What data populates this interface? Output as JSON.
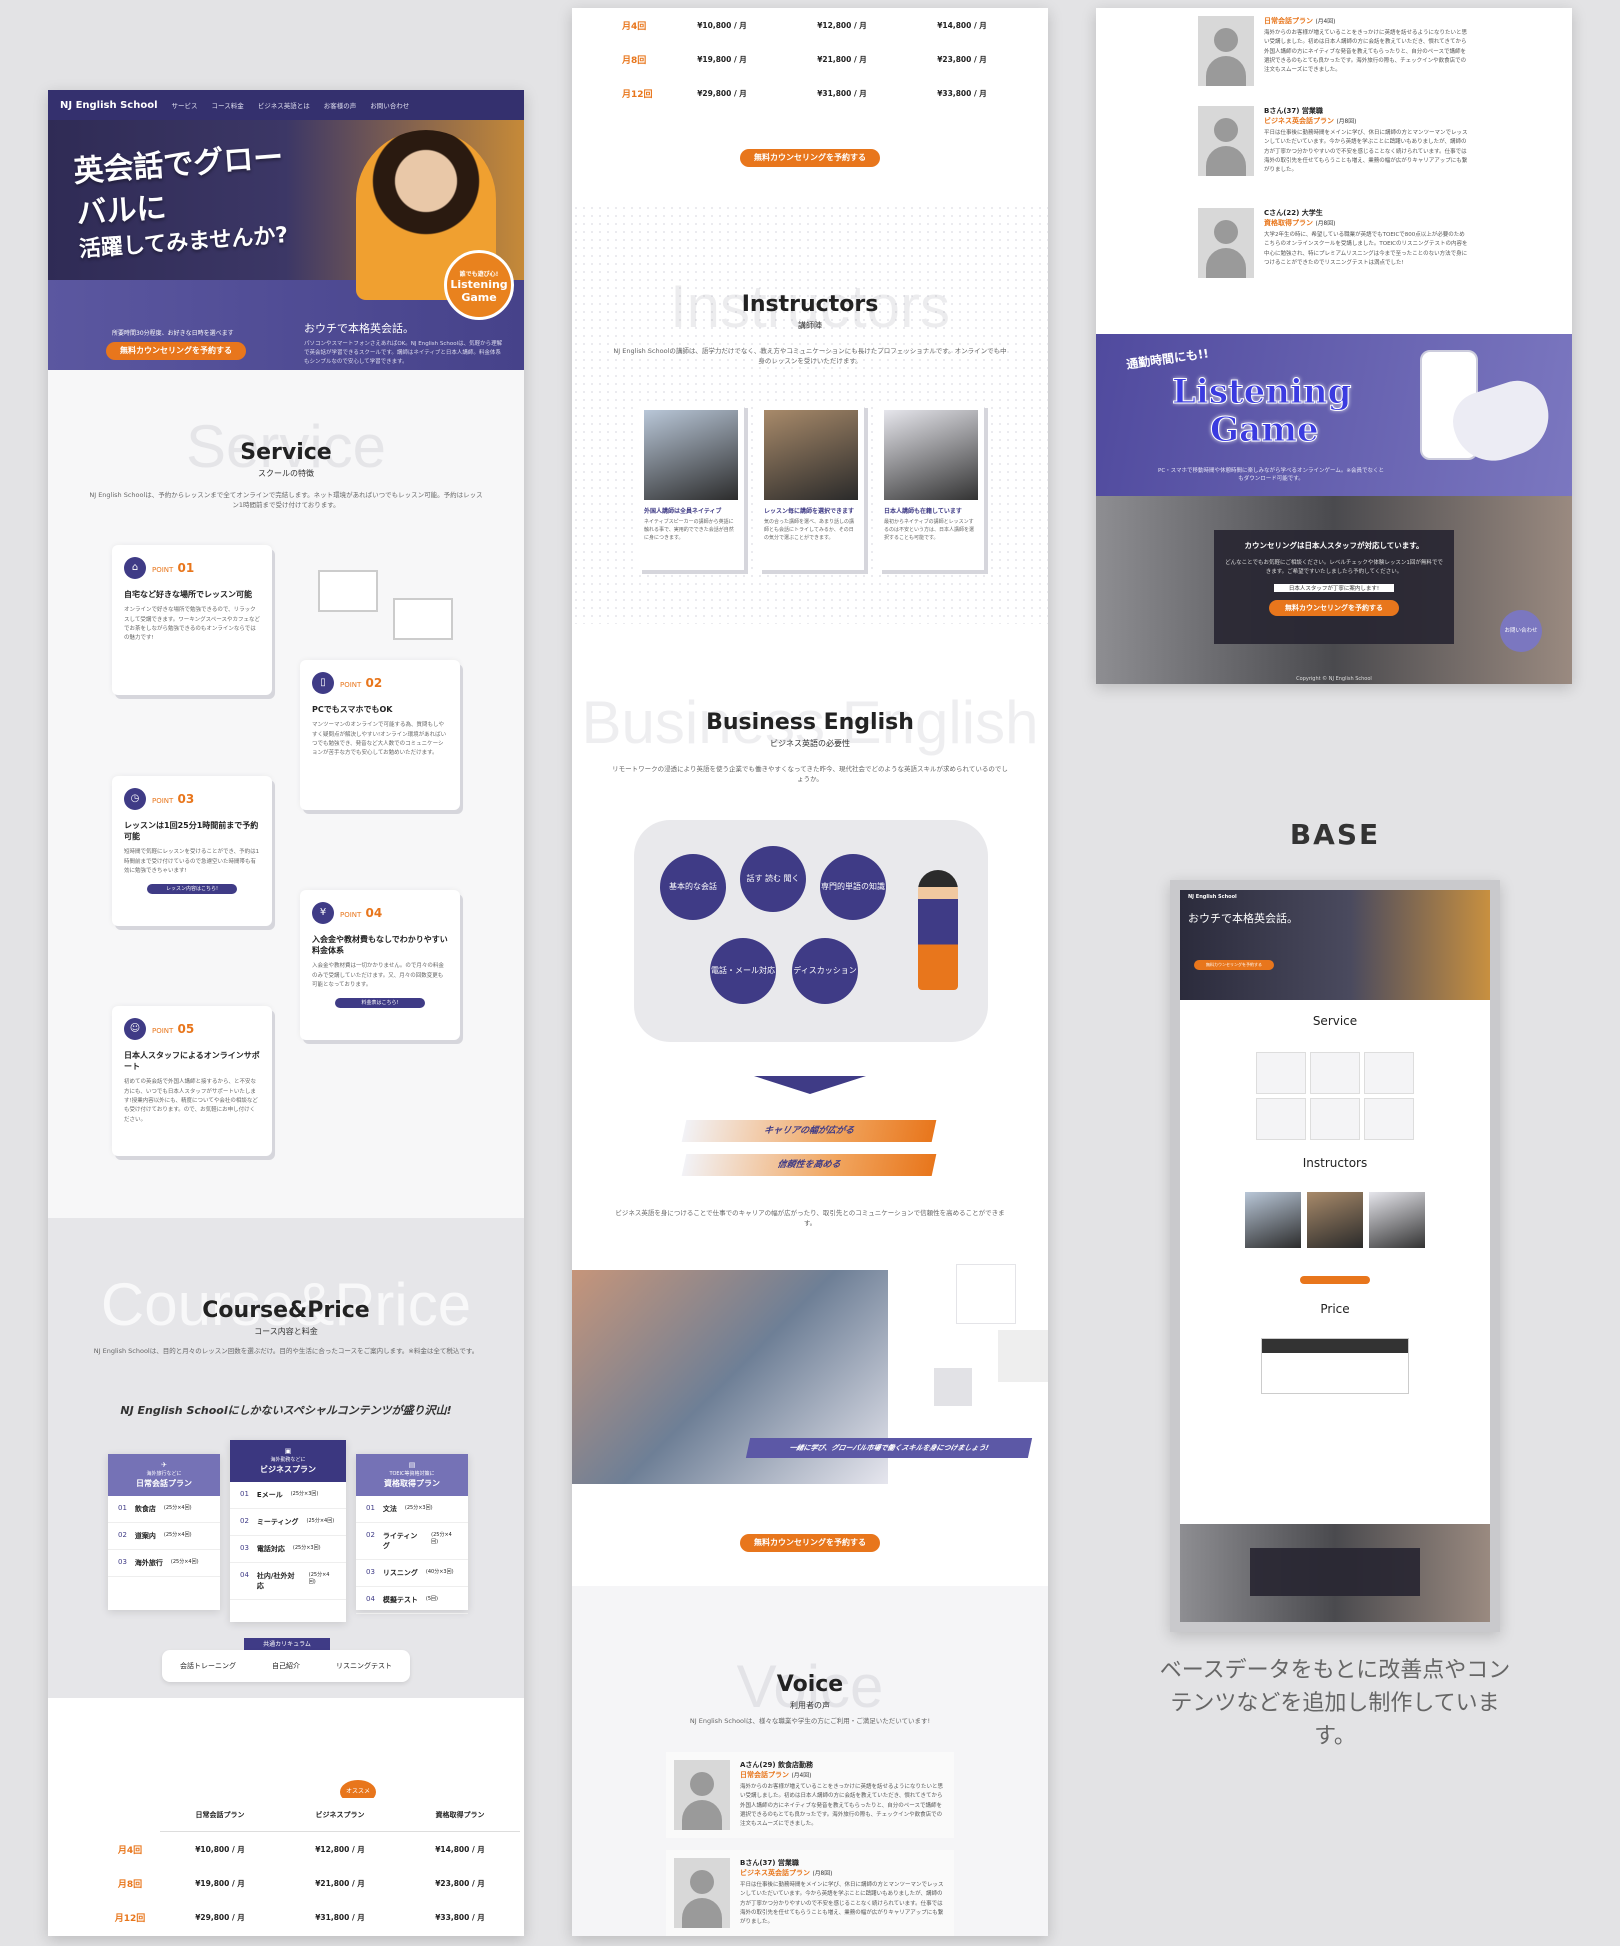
{
  "nav": {
    "logo": "NJ English School",
    "items": [
      "サービス",
      "コース料金",
      "ビジネス英語とは",
      "お客様の声",
      "お問い合わせ"
    ]
  },
  "hero": {
    "copy1": "英会話でグローバルに",
    "copy2": "活躍してみませんか?",
    "badge_small": "誰でも遊び心!",
    "badge": "Listening Game",
    "note": "所要時間30分程度、お好きな日時を選べます",
    "cta": "無料カウンセリングを予約する",
    "title": "おウチで本格英会話。",
    "desc": "パソコンやスマートフォンさえあればOK。NJ English Schoolは、気軽から理解で英会話が学習できるスクールです。講師はネイティブと日本人講師。料金体系もシンプルなので安心して学習できます。"
  },
  "service": {
    "bg": "Service",
    "title": "Service",
    "sub": "スクールの特徴",
    "lead": "NJ English Schoolは、予約からレッスンまで全てオンラインで完結します。ネット環境があればいつでもレッスン可能。予約はレッスン1時間前まで受け付けております。",
    "points": [
      {
        "icon": "house-icon",
        "num": "01",
        "title": "自宅など好きな場所でレッスン可能",
        "desc": "オンラインで好きな場所で勉強できるので、リラックスして受講できます。ワーキングスペースやカフェなどでお茶をしながら勉強できるのもオンラインならではの魅力です!"
      },
      {
        "icon": "phone-icon",
        "num": "02",
        "title": "PCでもスマホでもOK",
        "desc": "マンツーマンのオンラインで可能する為、質問もしやすく疑問点が解決しやすい!オンライン環境があればいつでも勉強でき、発音など大人数でのコミュニケーションが苦手な方でも安心してお勉めいただけます。"
      },
      {
        "icon": "clock-icon",
        "num": "03",
        "title": "レッスンは1回25分1時間前まで予約可能",
        "desc": "短時間で気軽にレッスンを受けることができ、予約は1時間前まで受け付けているので急遽空いた時間帯も有効に勉強できちゃいます!",
        "btn": "レッスン内容はこちら!"
      },
      {
        "icon": "piggy-icon",
        "num": "04",
        "title": "入会金や教材費もなしでわかりやすい料金体系",
        "desc": "入会金や教材費は一切かかりません。ので月々の料金のみで受講していただけます。又、月々の回数変更も可能となっております。",
        "btn": "料金表はこちら!"
      },
      {
        "icon": "smile-icon",
        "num": "05",
        "title": "日本人スタッフによるオンラインサポート",
        "desc": "初めての英会話で外国人講師と接するから、と不安な方にも、いつでも日本人スタッフがサポートいたします!授業内容以外にも、精度についてや会社の相談なども受け付けております。ので、お気軽にお申し付けください。"
      }
    ]
  },
  "course": {
    "bg": "Course&Price",
    "title": "Course&Price",
    "sub": "コース内容と料金",
    "lead": "NJ English Schoolは、目的と月々のレッスン回数を選ぶだけ。目的や生活に合ったコースをご案内します。※料金は全て税込です。",
    "catch": "NJ English Schoolにしかないスペシャルコンテンツが盛り沢山!",
    "plans": [
      {
        "small": "海外旅行などに",
        "name": "日常会話プラン",
        "items": [
          [
            "01",
            "飲食店",
            "(25分×4回)"
          ],
          [
            "02",
            "道案内",
            "(25分×4回)"
          ],
          [
            "03",
            "海外旅行",
            "(25分×4回)"
          ]
        ]
      },
      {
        "small": "海外勤務などに",
        "name": "ビジネスプラン",
        "items": [
          [
            "01",
            "Eメール",
            "(25分×3回)"
          ],
          [
            "02",
            "ミーティング",
            "(25分×4回)"
          ],
          [
            "03",
            "電話対応",
            "(25分×3回)"
          ],
          [
            "04",
            "社内/社外対応",
            "(25分×4回)"
          ]
        ]
      },
      {
        "small": "TOEIC等資格対策に",
        "name": "資格取得プラン",
        "items": [
          [
            "01",
            "文法",
            "(25分×3回)"
          ],
          [
            "02",
            "ライティング",
            "(25分×4回)"
          ],
          [
            "03",
            "リスニング",
            "(40分×3回)"
          ],
          [
            "04",
            "模擬テスト",
            "(5回)"
          ]
        ]
      }
    ],
    "common_tag": "共通カリキュラム",
    "common": [
      "会話トレーニング",
      "自己紹介",
      "リスニングテスト"
    ],
    "osusume": "オススメ"
  },
  "price": {
    "headers": [
      "日常会話プラン",
      "ビジネスプラン",
      "資格取得プラン"
    ],
    "rows": [
      {
        "label": "月4回",
        "cells": [
          "¥10,800 / 月",
          "¥12,800 / 月",
          "¥14,800 / 月"
        ]
      },
      {
        "label": "月8回",
        "cells": [
          "¥19,800 / 月",
          "¥21,800 / 月",
          "¥23,800 / 月"
        ]
      },
      {
        "label": "月12回",
        "cells": [
          "¥29,800 / 月",
          "¥31,800 / 月",
          "¥33,800 / 月"
        ]
      }
    ]
  },
  "cta": "無料カウンセリングを予約する",
  "instructors": {
    "bg": "Instructors",
    "title": "Instructors",
    "sub": "講師陣",
    "lead": "NJ English Schoolの講師は、語学力だけでなく、教え方やコミュニケーションにも長けたプロフェッショナルです。オンラインでも中身のレッスンを受けいただけます。",
    "items": [
      {
        "title": "外国人講師は全員ネイティブ",
        "desc": "ネイティブスピーカーの講師から英語に触れる事で、実用的でできた会話が自然に身につきます。"
      },
      {
        "title": "レッスン毎に講師を選択できます",
        "desc": "気の合った講師を選べ、あまり話しの講師とも会話にトライしてみるか、その日の気分で選ぶことができます。"
      },
      {
        "title": "日本人講師も在籍しています",
        "desc": "最初からネイティブの講師とレッスンするのは不安という方は、日本人講師を選択することも可能です。"
      }
    ]
  },
  "business": {
    "bg": "Business English",
    "title": "Business English",
    "sub": "ビジネス英語の必要性",
    "lead": "リモートワークの浸透により英語を使う企業でも働きやすくなってきた昨今、現代社会でどのような英語スキルが求められているのでしょうか。",
    "bubbles": [
      "基本的な会話",
      "話す 読む 聞く",
      "専門的単語の知識",
      "電話・メール対応",
      "ディスカッション"
    ],
    "r1": "キャリアの幅が広がる",
    "r2": "信頼性を高める",
    "lead2": "ビジネス英語を身につけることで仕事でのキャリアの幅が広がったり、取引先とのコミュニケーションで信頼性を高めることができます。",
    "photo_caption": "一緒に学び、グローバル市場で働くスキルを身につけましょう!"
  },
  "voice": {
    "bg": "Voice",
    "title": "Voice",
    "sub": "利用者の声",
    "lead": "NJ English Schoolは、様々な職業や学生の方にご利用・ご満足いただいています!",
    "items": [
      {
        "name": "Aさん(29) 飲食店勤務",
        "plan": "日常会話プラン",
        "count": "(月4回)",
        "text": "海外からのお客様が増えていることをきっかけに英語を話せるようになりたいと思い受講しました。初めは日本人講師の方に会話を教えていただき、慣れてきてから外国人講師の方にネイティブな発音を教えてもらったりと、自分のペースで講師を選択できるのもとても良かったです。海外旅行の際も、チェックインや飲食店での注文もスムーズにできました。"
      },
      {
        "name": "Bさん(37) 営業職",
        "plan": "ビジネス英会話プラン",
        "count": "(月8回)",
        "text": "平日は仕事後に勤務時間をメインに学び、休日に講師の方とマンツーマンでレッスンしていただいています。今から英語を学ぶことに躊躇いもありましたが、講師の方が丁寧かつ分かりやすいので不安を感じることなく続けられています。仕事では海外の取引先を任せてもらうことも増え、業務の幅が広がりキャリアアップにも繋がりました。"
      },
      {
        "name": "Cさん(22) 大学生",
        "plan": "資格取得プラン",
        "count": "(月8回)",
        "text": "大学2年生の時に、希望している職業が英語でもTOEICで800点以上が必要のためこちらのオンラインスクールを受講しました。TOEICのリスニングテストの内容を中心に勉強され、特にプレミアムリスニングは今まで至ったことのない方法で身につけることができたのでリスニングテストは満点でした!"
      }
    ]
  },
  "listening": {
    "pre": "通勤時間にも!!",
    "title1": "Listening",
    "title2": "Game",
    "desc": "PC・スマホで移動時間や休憩時間に楽しみながら学べるオンラインゲーム。※会員でなくともダウンロード可能です。"
  },
  "support": {
    "title": "カウンセリングは日本人スタッフが対応しています。",
    "desc": "どんなことでもお気軽にご相談ください。レベルチェックや体験レッスン1回が無料でできます。ご希望ですいたしましたら予約してください。",
    "tag": "日本人スタッフが丁寧に案内します!",
    "contact": "お問い合わせ",
    "copyright": "Copyright © NJ English School"
  },
  "base": {
    "label": "BASE",
    "hero": "おウチで本格英会話。",
    "service": "Service",
    "instructors": "Instructors",
    "price": "Price",
    "caption": "ベースデータをもとに改善点やコンテンツなどを追加し制作しています。"
  },
  "colors": {
    "primary": "#3f3b86",
    "accent": "#e8761c",
    "bg": "#e3e3e5"
  }
}
